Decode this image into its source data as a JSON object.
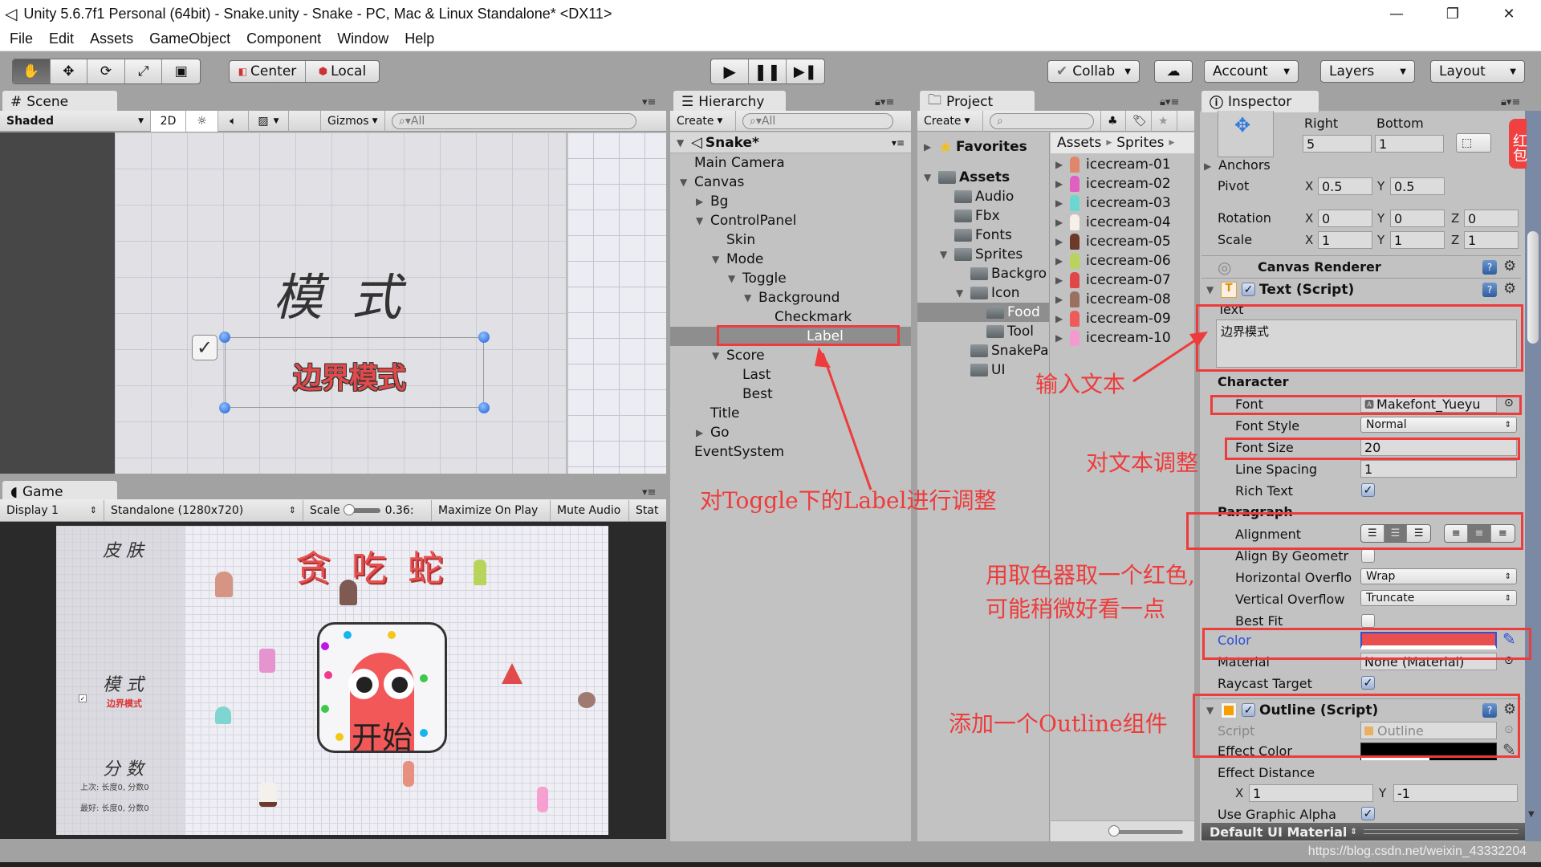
{
  "window": {
    "title": "Unity 5.6.7f1 Personal (64bit) - Snake.unity - Snake - PC, Mac & Linux Standalone* <DX11>",
    "controls": [
      "minimize",
      "restore",
      "close"
    ]
  },
  "menu": [
    "File",
    "Edit",
    "Assets",
    "GameObject",
    "Component",
    "Window",
    "Help"
  ],
  "toolbar": {
    "tools": [
      "hand-tool",
      "move-tool",
      "rotate-tool",
      "scale-tool",
      "rect-tool"
    ],
    "pivot_label": "Center",
    "space_label": "Local",
    "play": [
      "play",
      "pause",
      "step"
    ],
    "collab_label": "Collab",
    "account_label": "Account",
    "layers_label": "Layers",
    "layout_label": "Layout"
  },
  "scene": {
    "tab_label": "Scene",
    "shading": "Shaded",
    "mode_2d": "2D",
    "gizmos_label": "Gizmos",
    "search_placeholder": "All",
    "heading": "模 式",
    "label_text": "边界模式"
  },
  "game": {
    "tab_label": "Game",
    "display": "Display 1",
    "resolution": "Standalone (1280x720)",
    "scale_label": "Scale",
    "scale_value": "0.36:",
    "maximize_label": "Maximize On Play",
    "mute_label": "Mute Audio",
    "stats_label": "Stat",
    "title": "贪 吃 蛇",
    "skin_label": "皮 肤",
    "mode_label": "模 式",
    "mode_toggle_label": "边界模式",
    "score_label": "分 数",
    "last_score": "上次: 长度0, 分数0",
    "best_score": "最好: 长度0, 分数0",
    "start_label": "开始"
  },
  "hierarchy": {
    "tab_label": "Hierarchy",
    "create_label": "Create",
    "search_placeholder": "All",
    "scene_name": "Snake*",
    "items": [
      {
        "label": "Main Camera",
        "depth": 1,
        "expander": "none"
      },
      {
        "label": "Canvas",
        "depth": 1,
        "expander": "open"
      },
      {
        "label": "Bg",
        "depth": 2,
        "expander": "closed"
      },
      {
        "label": "ControlPanel",
        "depth": 2,
        "expander": "open"
      },
      {
        "label": "Skin",
        "depth": 3,
        "expander": "none"
      },
      {
        "label": "Mode",
        "depth": 3,
        "expander": "open"
      },
      {
        "label": "Toggle",
        "depth": 4,
        "expander": "open"
      },
      {
        "label": "Background",
        "depth": 5,
        "expander": "open"
      },
      {
        "label": "Checkmark",
        "depth": 6,
        "expander": "none"
      },
      {
        "label": "Label",
        "depth": 5,
        "expander": "none",
        "selected": true
      },
      {
        "label": "Score",
        "depth": 3,
        "expander": "open"
      },
      {
        "label": "Last",
        "depth": 4,
        "expander": "none"
      },
      {
        "label": "Best",
        "depth": 4,
        "expander": "none"
      },
      {
        "label": "Title",
        "depth": 2,
        "expander": "none"
      },
      {
        "label": "Go",
        "depth": 2,
        "expander": "closed"
      },
      {
        "label": "EventSystem",
        "depth": 1,
        "expander": "none"
      }
    ]
  },
  "project": {
    "tab_label": "Project",
    "create_label": "Create",
    "favorites_label": "Favorites",
    "breadcrumb": [
      "Assets",
      "Sprites"
    ],
    "tree": [
      {
        "label": "Assets",
        "depth": 0,
        "bold": true
      },
      {
        "label": "Audio",
        "depth": 1
      },
      {
        "label": "Fbx",
        "depth": 1
      },
      {
        "label": "Fonts",
        "depth": 1
      },
      {
        "label": "Sprites",
        "depth": 1
      },
      {
        "label": "Backgro",
        "depth": 2
      },
      {
        "label": "Icon",
        "depth": 2
      },
      {
        "label": "Food",
        "depth": 3,
        "selected": true
      },
      {
        "label": "Tool",
        "depth": 3
      },
      {
        "label": "SnakePa",
        "depth": 2
      },
      {
        "label": "UI",
        "depth": 2
      }
    ],
    "files": [
      {
        "name": "icecream-01",
        "color": "#e0866a"
      },
      {
        "name": "icecream-02",
        "color": "#e05fc0"
      },
      {
        "name": "icecream-03",
        "color": "#6cd6d0"
      },
      {
        "name": "icecream-04",
        "color": "#f5f0e8"
      },
      {
        "name": "icecream-05",
        "color": "#6b3a2a"
      },
      {
        "name": "icecream-06",
        "color": "#b9d45a"
      },
      {
        "name": "icecream-07",
        "color": "#e04848"
      },
      {
        "name": "icecream-08",
        "color": "#9a7060"
      },
      {
        "name": "icecream-09",
        "color": "#f05a5a"
      },
      {
        "name": "icecream-10",
        "color": "#f59ad0"
      }
    ]
  },
  "inspector": {
    "tab_label": "Inspector",
    "rect": {
      "right_label": "Right",
      "bottom_label": "Bottom",
      "right": "5",
      "bottom": "1"
    },
    "anchors_label": "Anchors",
    "pivot": {
      "label": "Pivot",
      "x": "0.5",
      "y": "0.5"
    },
    "rotation": {
      "label": "Rotation",
      "x": "0",
      "y": "0",
      "z": "0"
    },
    "scale": {
      "label": "Scale",
      "x": "1",
      "y": "1",
      "z": "1"
    },
    "canvas_renderer_label": "Canvas Renderer",
    "text_component": {
      "title": "Text (Script)",
      "text_label": "Text",
      "text_value": "边界模式",
      "character_label": "Character",
      "font_label": "Font",
      "font_value": "Makefont_Yueyu",
      "font_style_label": "Font Style",
      "font_style_value": "Normal",
      "font_size_label": "Font Size",
      "font_size_value": "20",
      "line_spacing_label": "Line Spacing",
      "line_spacing_value": "1",
      "rich_text_label": "Rich Text",
      "rich_text": true,
      "paragraph_label": "Paragraph",
      "alignment_label": "Alignment",
      "align_by_geometry_label": "Align By Geometr",
      "align_by_geometry": false,
      "h_overflow_label": "Horizontal Overflo",
      "h_overflow_value": "Wrap",
      "v_overflow_label": "Vertical Overflow",
      "v_overflow_value": "Truncate",
      "best_fit_label": "Best Fit",
      "best_fit": false,
      "color_label": "Color",
      "color_value": "#e85050",
      "material_label": "Material",
      "material_value": "None (Material)",
      "raycast_label": "Raycast Target",
      "raycast": true
    },
    "outline_component": {
      "title": "Outline (Script)",
      "script_label": "Script",
      "script_value": "Outline",
      "effect_color_label": "Effect Color",
      "effect_color_value": "#000000",
      "effect_distance_label": "Effect Distance",
      "distance_x": "1",
      "distance_y": "-1",
      "use_graphic_alpha_label": "Use Graphic Alpha",
      "use_graphic_alpha": true
    },
    "material_bar_label": "Default UI Material",
    "red_packet_label": "红包"
  },
  "annotations": {
    "input_text": "输入文本",
    "adjust_text": "对文本调整",
    "adjust_label": "对Toggle下的Label进行调整",
    "pick_color_1": "用取色器取一个红色,",
    "pick_color_2": "可能稍微好看一点",
    "add_outline": "添加一个Outline组件",
    "color": "#ee3b3b"
  },
  "watermark": "https://blog.csdn.net/weixin_43332204"
}
